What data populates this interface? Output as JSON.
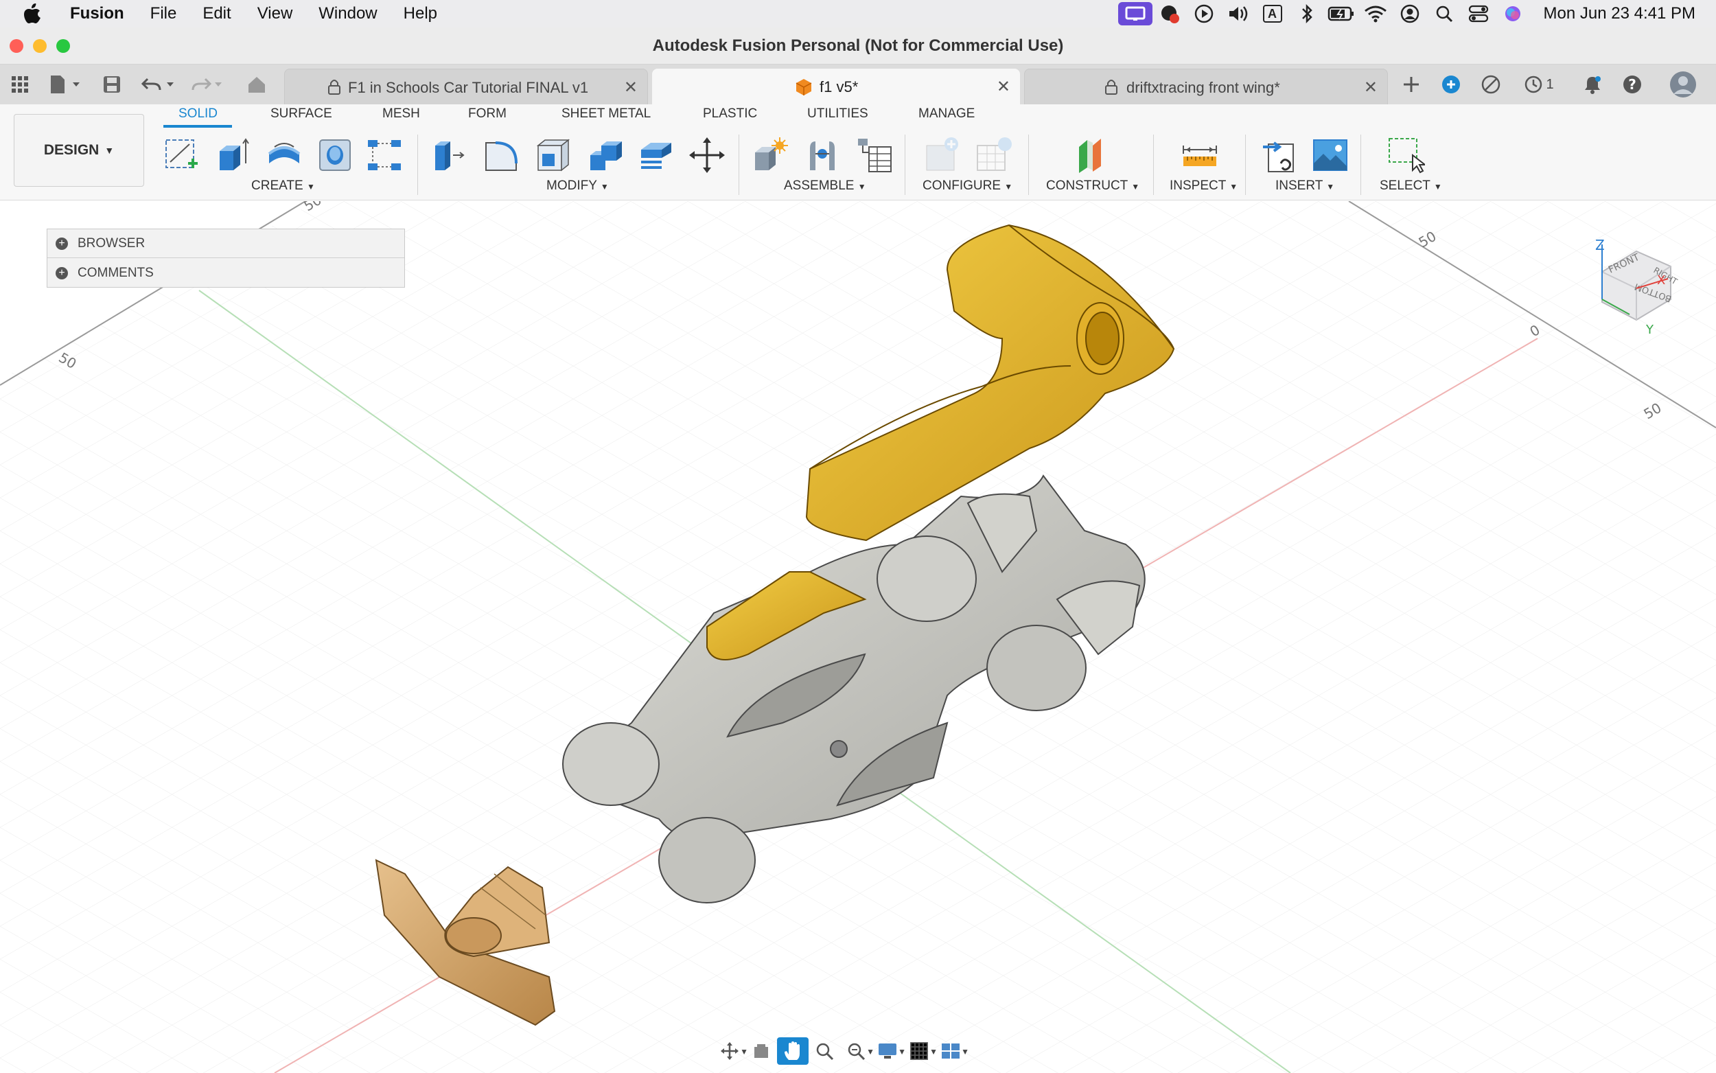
{
  "menubar": {
    "app_name": "Fusion",
    "menus": [
      "File",
      "Edit",
      "View",
      "Window",
      "Help"
    ],
    "clock": "Mon Jun 23  4:41 PM"
  },
  "window": {
    "title": "Autodesk Fusion Personal (Not for Commercial Use)"
  },
  "tabs": [
    {
      "label": "F1 in Schools Car Tutorial FINAL v1",
      "locked": true,
      "active": false
    },
    {
      "label": "f1 v5*",
      "locked": false,
      "active": true
    },
    {
      "label": "driftxtracing front wing*",
      "locked": true,
      "active": false
    }
  ],
  "tabstrip_right": {
    "jobs_count": "1"
  },
  "ribbon": {
    "workspace": "DESIGN",
    "tabs": [
      "SOLID",
      "SURFACE",
      "MESH",
      "FORM",
      "SHEET METAL",
      "PLASTIC",
      "UTILITIES",
      "MANAGE"
    ],
    "active_tab": "SOLID",
    "groups": [
      "CREATE",
      "MODIFY",
      "ASSEMBLE",
      "CONFIGURE",
      "CONSTRUCT",
      "INSPECT",
      "INSERT",
      "SELECT"
    ]
  },
  "browser_panel": {
    "rows": [
      "BROWSER",
      "COMMENTS"
    ]
  },
  "viewport": {
    "grid_labels": [
      "50",
      "50",
      "50",
      "0",
      "50"
    ],
    "viewcube_faces": [
      "FRONT",
      "RIGHT",
      "BOTTOM"
    ],
    "axes": [
      "Z",
      "X",
      "Y"
    ]
  },
  "colors": {
    "accent": "#1a87d0",
    "part_yellow": "#e8b92e",
    "part_gray": "#c9c9c4",
    "part_wood": "#d6aa72"
  }
}
